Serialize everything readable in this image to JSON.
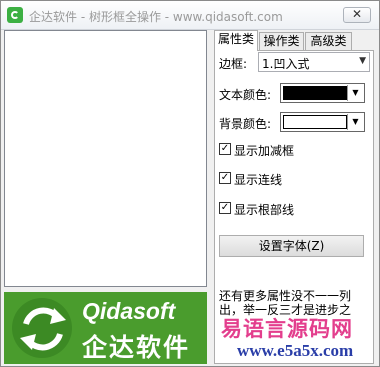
{
  "window": {
    "title": "企达软件 - 树形框全操作 - www.qidasoft.com",
    "close_label": "✕"
  },
  "tabs": [
    {
      "label": "属性类",
      "active": true
    },
    {
      "label": "操作类",
      "active": false
    },
    {
      "label": "高级类",
      "active": false
    }
  ],
  "props": {
    "border_label": "边框:",
    "border_value": "1.凹入式",
    "text_color_label": "文本颜色:",
    "text_color": "#000000",
    "bg_color_label": "背景颜色:",
    "bg_color": "#ffffff"
  },
  "checkboxes": [
    {
      "label": "显示加减框",
      "checked": true
    },
    {
      "label": "显示连线",
      "checked": true
    },
    {
      "label": "显示根部线",
      "checked": true
    }
  ],
  "font_button": "设置字体(Z)",
  "info_text": "还有更多属性没不一一列出，举一反三才是进步之",
  "logo": {
    "en": "Qidasoft",
    "cn": "企达软件"
  },
  "watermark": {
    "line1": "易语言源码网",
    "line2": "www.e5a5x.com"
  }
}
